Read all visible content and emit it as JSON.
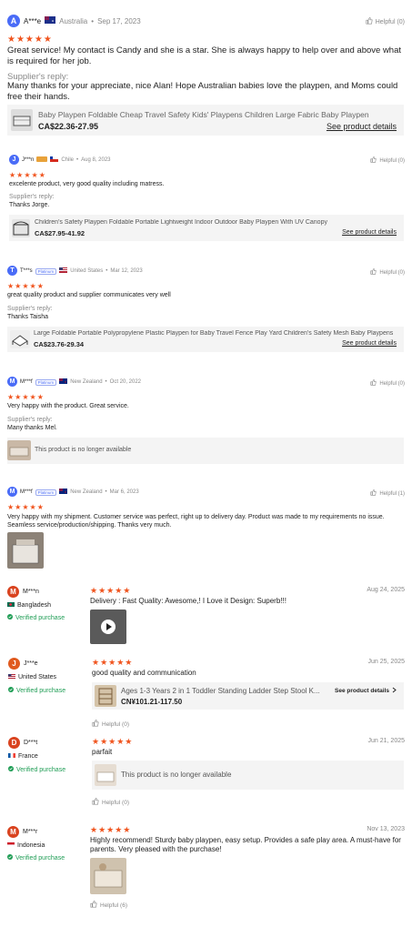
{
  "colors": {
    "star": "#f0541e",
    "verified": "#1f9d55",
    "avatar_blue": "#4a6cf7",
    "avatar_orange": "#e05a1f",
    "avatar_red": "#d9431f"
  },
  "r1": {
    "initial": "A",
    "name": "A***e",
    "country": "Australia",
    "date": "Sep 17, 2023",
    "helpful": "Helpful (0)",
    "stars": "★★★★★",
    "text": "Great service! My contact is Candy and she is a star. She is always happy to help over and above what is required for her job.",
    "reply_label": "Supplier's reply:",
    "reply": "Many thanks for your appreciate, nice Alan! Hope Australian babies love the playpen, and Moms could free their hands.",
    "product": "Baby Playpen Foldable Cheap Travel Safety Kids' Playpens Children Large Fabric Baby Playpen",
    "price": "CA$22.36-27.95",
    "see": "See product details"
  },
  "r2": {
    "initial": "J",
    "name": "J***n",
    "country": "Chile",
    "date": "Aug 8, 2023",
    "helpful": "Helpful (0)",
    "stars": "★★★★★",
    "text": "excelente product, very good quality including matress.",
    "reply_label": "Supplier's reply:",
    "reply": "Thanks Jorge.",
    "product": "Children's Safety Playpen Foldable Portable Lightweight Indoor Outdoor Baby Playpen With UV Canopy",
    "price": "CA$27.95-41.92",
    "see": "See product details"
  },
  "r3": {
    "initial": "T",
    "name": "T***s",
    "badge": "Platinum",
    "country": "United States",
    "date": "Mar 12, 2023",
    "helpful": "Helpful (0)",
    "stars": "★★★★★",
    "text": "great quality product and supplier communicates very well",
    "reply_label": "Supplier's reply:",
    "reply": "Thanks Taisha",
    "product": "Large Foldable Portable Polypropylene Plastic Playpen for Baby Travel Fence Play Yard Children's Safety Mesh Baby Playpens",
    "price": "CA$23.76-29.34",
    "see": "See product details"
  },
  "r4": {
    "initial": "M",
    "name": "M***f",
    "badge": "Platinum",
    "country": "New Zealand",
    "date": "Oct 20, 2022",
    "helpful": "Helpful (0)",
    "stars": "★★★★★",
    "text": "Very happy with the product. Great service.",
    "reply_label": "Supplier's reply:",
    "reply": "Many thanks Mel.",
    "unavailable": "This product is no longer available"
  },
  "r5": {
    "initial": "M",
    "name": "M***f",
    "badge": "Platinum",
    "country": "New Zealand",
    "date": "Mar 6, 2023",
    "helpful": "Helpful (1)",
    "stars": "★★★★★",
    "text": "Very happy with my shipment. Customer service was perfect, right up to delivery day. Product was made to my requirements no issue. Seamless service/production/shipping. Thanks very much."
  },
  "r6": {
    "initial": "M",
    "name": "M***n",
    "country": "Bangladesh",
    "verified": "Verified purchase",
    "date": "Aug 24, 2025",
    "stars": "★★★★★",
    "text": "Delivery : Fast Quality: Awesome,! I Love it Design: Superb!!!"
  },
  "r7": {
    "initial": "J",
    "name": "J***e",
    "country": "United States",
    "verified": "Verified purchase",
    "date": "Jun 25, 2025",
    "stars": "★★★★★",
    "text": "good quality and communication",
    "product": "Ages 1-3 Years 2 in 1 Toddler Standing Ladder Step Stool K...",
    "price": "CN¥101.21-117.50",
    "see": "See product details",
    "helpful": "Helpful (0)"
  },
  "r8": {
    "initial": "D",
    "name": "D***t",
    "country": "France",
    "verified": "Verified purchase",
    "date": "Jun 21, 2025",
    "stars": "★★★★★",
    "text": "parfait",
    "unavailable": "This product is no longer available",
    "helpful": "Helpful (0)"
  },
  "r9": {
    "initial": "M",
    "name": "M***r",
    "country": "Indonesia",
    "verified": "Verified purchase",
    "date": "Nov 13, 2023",
    "stars": "★★★★★",
    "text": "Highly recommend! Sturdy baby playpen, easy setup. Provides a safe play area. A must-have for parents. Very pleased with the purchase!",
    "helpful": "Helpful (6)"
  }
}
